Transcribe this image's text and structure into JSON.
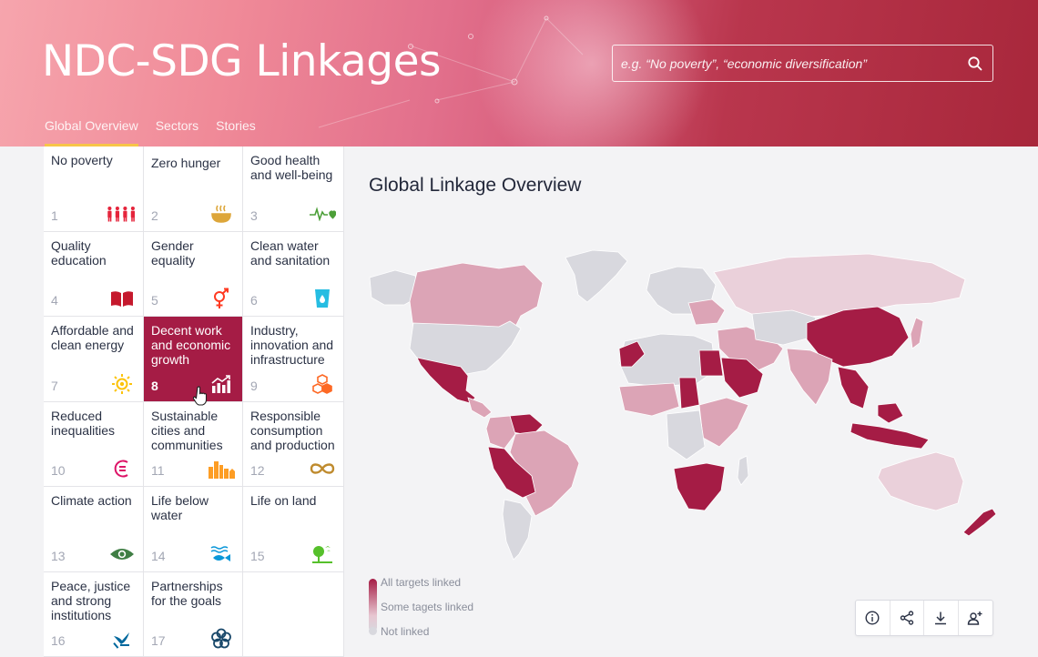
{
  "header": {
    "title": "NDC-SDG Linkages",
    "search_placeholder": "e.g. “No poverty”, “economic diversification”",
    "tabs": [
      "Global Overview",
      "Sectors",
      "Stories"
    ],
    "active_tab": "Global Overview"
  },
  "goals": [
    {
      "number": "1",
      "label": "No poverty",
      "icon": "people-family-icon",
      "color": "#e5243b"
    },
    {
      "number": "2",
      "label": "Zero hunger",
      "icon": "food-bowl-icon",
      "color": "#dda63a"
    },
    {
      "number": "3",
      "label": "Good health and well-being",
      "icon": "heartbeat-icon",
      "color": "#4c9f38"
    },
    {
      "number": "4",
      "label": "Quality education",
      "icon": "book-icon",
      "color": "#c5192d"
    },
    {
      "number": "5",
      "label": "Gender equality",
      "icon": "gender-symbol-icon",
      "color": "#ff3a21"
    },
    {
      "number": "6",
      "label": "Clean water and sanitation",
      "icon": "water-glass-icon",
      "color": "#26bde2"
    },
    {
      "number": "7",
      "label": "Affordable and clean energy",
      "icon": "sun-icon",
      "color": "#fcc30b"
    },
    {
      "number": "8",
      "label": "Decent work and economic growth",
      "icon": "growth-chart-icon",
      "color": "#a21942"
    },
    {
      "number": "9",
      "label": "Industry, innovation and infrastructure",
      "icon": "cubes-icon",
      "color": "#fd6925"
    },
    {
      "number": "10",
      "label": "Reduced inequalities",
      "icon": "equality-icon",
      "color": "#dd1367"
    },
    {
      "number": "11",
      "label": "Sustainable cities and communities",
      "icon": "city-icon",
      "color": "#fd9d24"
    },
    {
      "number": "12",
      "label": "Responsible consumption and production",
      "icon": "infinity-icon",
      "color": "#bf8b2e"
    },
    {
      "number": "13",
      "label": "Climate action",
      "icon": "eye-globe-icon",
      "color": "#3f7e44"
    },
    {
      "number": "14",
      "label": "Life below water",
      "icon": "fish-icon",
      "color": "#0a97d9"
    },
    {
      "number": "15",
      "label": "Life on land",
      "icon": "tree-bird-icon",
      "color": "#56c02b"
    },
    {
      "number": "16",
      "label": "Peace, justice and strong institutions",
      "icon": "dove-icon",
      "color": "#00689d"
    },
    {
      "number": "17",
      "label": "Partnerships for the goals",
      "icon": "flower-rings-icon",
      "color": "#19486a"
    }
  ],
  "active_goal": "8",
  "main": {
    "title": "Global Linkage Overview",
    "legend": [
      "All targets linked",
      "Some tagets linked",
      "Not linked"
    ],
    "colors": {
      "all": "#a51c45",
      "some": "#dca4b6",
      "some_light": "#ead0da",
      "none": "#d8d8de"
    }
  },
  "toolbar": {
    "buttons": [
      "info-icon",
      "share-icon",
      "download-icon",
      "add-user-icon"
    ]
  }
}
